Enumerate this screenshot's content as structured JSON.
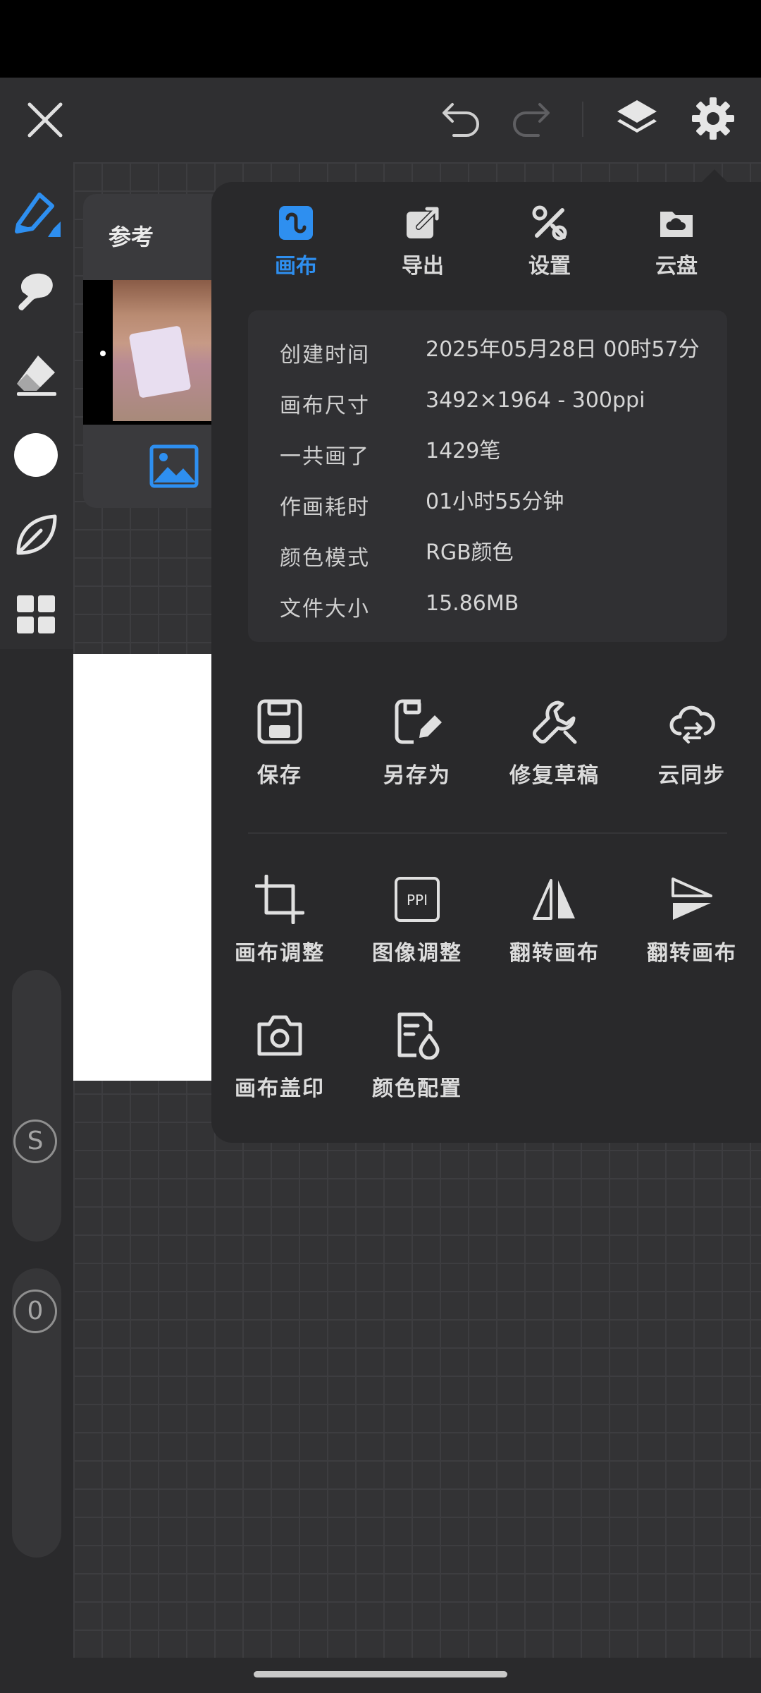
{
  "toolbar": {
    "close_icon": "close-icon",
    "undo_icon": "undo-icon",
    "redo_icon": "redo-icon",
    "layers_icon": "layers-icon",
    "settings_icon": "gear-icon"
  },
  "reference_panel": {
    "title": "参考"
  },
  "menu": {
    "tabs": [
      {
        "label": "画布",
        "icon": "canvas-icon",
        "active": true
      },
      {
        "label": "导出",
        "icon": "export-icon",
        "active": false
      },
      {
        "label": "设置",
        "icon": "tools-icon",
        "active": false
      },
      {
        "label": "云盘",
        "icon": "cloud-drive-icon",
        "active": false
      }
    ],
    "info": [
      {
        "key": "创建时间",
        "value": "2025年05月28日 00时57分"
      },
      {
        "key": "画布尺寸",
        "value": "3492×1964 - 300ppi"
      },
      {
        "key": "一共画了",
        "value": "1429笔"
      },
      {
        "key": "作画耗时",
        "value": "01小时55分钟"
      },
      {
        "key": "颜色模式",
        "value": "RGB颜色"
      },
      {
        "key": "文件大小",
        "value": "15.86MB"
      }
    ],
    "actions_row1": [
      {
        "label": "保存",
        "icon": "save-icon"
      },
      {
        "label": "另存为",
        "icon": "save-as-icon"
      },
      {
        "label": "修复草稿",
        "icon": "wrench-icon"
      },
      {
        "label": "云同步",
        "icon": "cloud-sync-icon"
      }
    ],
    "actions_row2": [
      {
        "label": "画布调整",
        "icon": "crop-icon"
      },
      {
        "label": "图像调整",
        "icon": "ppi-icon"
      },
      {
        "label": "翻转画布",
        "icon": "flip-horizontal-icon"
      },
      {
        "label": "翻转画布",
        "icon": "flip-vertical-icon"
      }
    ],
    "actions_row3": [
      {
        "label": "画布盖印",
        "icon": "camera-icon"
      },
      {
        "label": "颜色配置",
        "icon": "color-profile-icon"
      }
    ]
  },
  "sliders": {
    "size_label": "S",
    "opacity_label": "0"
  },
  "colors": {
    "accent": "#2e8ff0",
    "background": "#2b2b2d",
    "menu": "#29292b"
  }
}
